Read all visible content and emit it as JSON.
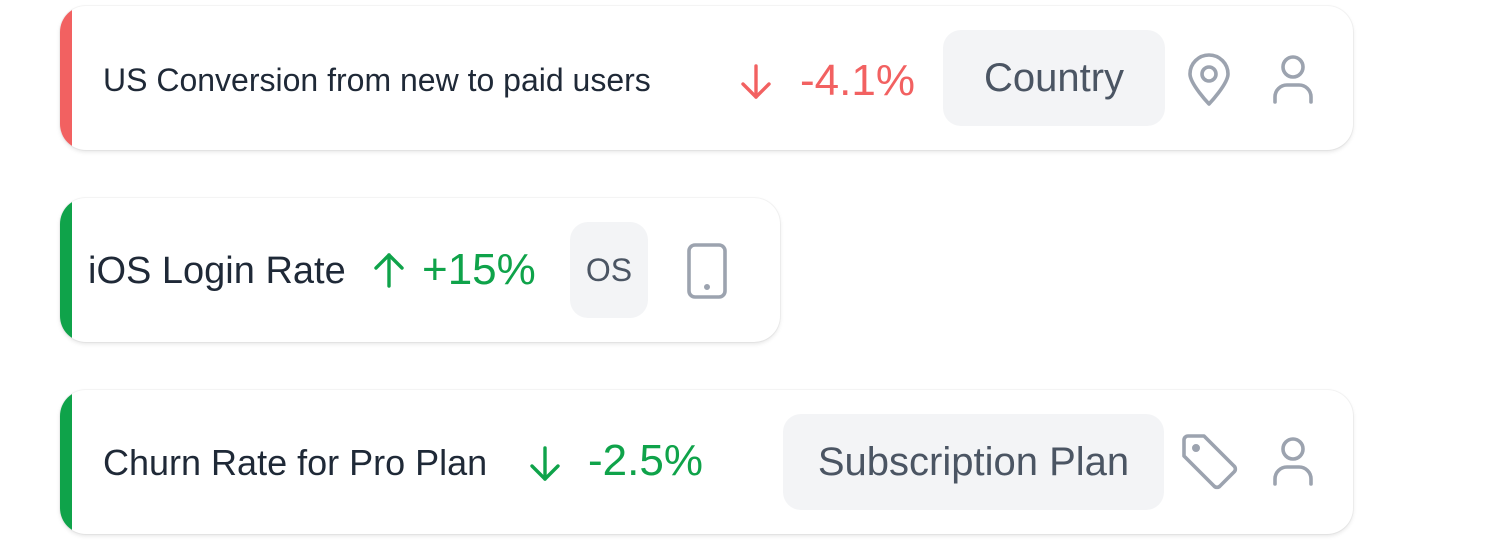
{
  "colors": {
    "negative": "#f26161",
    "positive": "#0fa34a",
    "icon": "#9ca3af",
    "pill_bg": "#f3f4f6",
    "pill_text": "#4b5563",
    "title_text": "#1f2937"
  },
  "insights": [
    {
      "title": "US Conversion from new to paid users",
      "direction": "down",
      "change": "-4.1%",
      "sentiment": "negative",
      "dimension": "Country",
      "icons": [
        "map-pin-icon",
        "user-icon"
      ]
    },
    {
      "title": "iOS Login Rate",
      "direction": "up",
      "change": "+15%",
      "sentiment": "positive",
      "dimension": "OS",
      "icons": [
        "tablet-icon"
      ]
    },
    {
      "title": "Churn Rate for Pro Plan",
      "direction": "down",
      "change": "-2.5%",
      "sentiment": "positive",
      "dimension": "Subscription Plan",
      "icons": [
        "tag-icon",
        "user-icon"
      ]
    }
  ]
}
